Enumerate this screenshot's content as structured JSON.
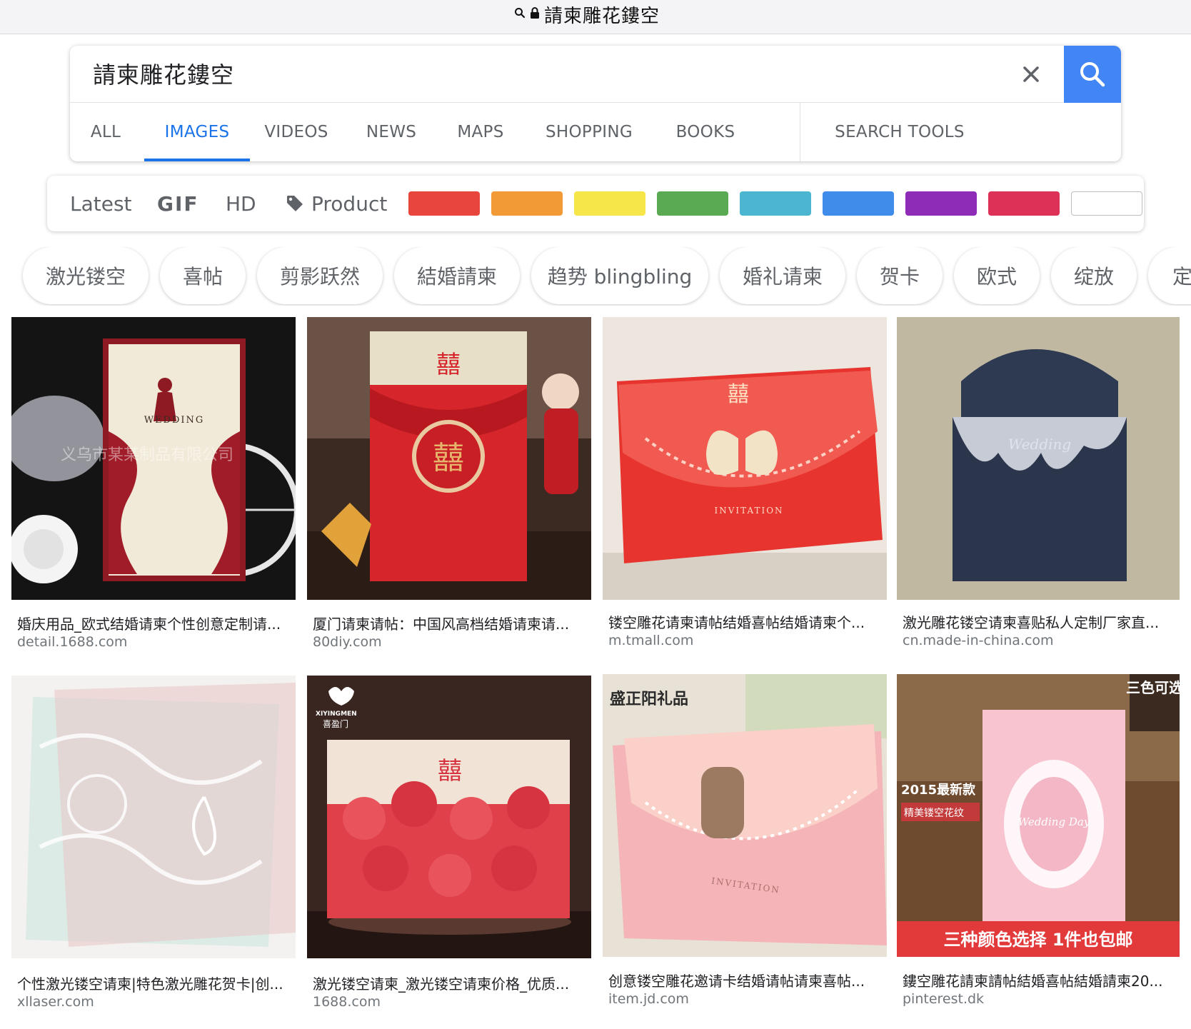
{
  "address_bar": {
    "url_text": "請柬雕花鏤空"
  },
  "search": {
    "query": "請柬雕花鏤空",
    "tabs": [
      {
        "label": "ALL",
        "active": false
      },
      {
        "label": "IMAGES",
        "active": true
      },
      {
        "label": "VIDEOS",
        "active": false
      },
      {
        "label": "NEWS",
        "active": false
      },
      {
        "label": "MAPS",
        "active": false
      },
      {
        "label": "SHOPPING",
        "active": false
      },
      {
        "label": "BOOKS",
        "active": false
      },
      {
        "label": "SEARCH TOOLS",
        "active": false
      }
    ],
    "accent_color": "#4285f4"
  },
  "filters": {
    "latest": "Latest",
    "gif": "GIF",
    "hd": "HD",
    "product": "Product",
    "colors": [
      "#e8453c",
      "#f29b36",
      "#f7e64a",
      "#5aaa54",
      "#4cb6d0",
      "#3f8ceb",
      "#8e2cb8",
      "#de3158",
      "#ffffff"
    ]
  },
  "chips": [
    "激光镂空",
    "喜帖",
    "剪影跃然",
    "結婚請柬",
    "趋势 blingbling",
    "婚礼请柬",
    "贺卡",
    "欧式",
    "绽放",
    "定"
  ],
  "results": [
    {
      "title": "婚庆用品_欧式结婚请柬个性创意定制请...",
      "source": "detail.1688.com"
    },
    {
      "title": "厦门请柬请帖：中国风高档结婚请柬请...",
      "source": "80diy.com"
    },
    {
      "title": "镂空雕花请柬请帖结婚喜帖结婚请柬个...",
      "source": "m.tmall.com"
    },
    {
      "title": "激光雕花镂空请柬喜贴私人定制厂家直...",
      "source": "cn.made-in-china.com"
    },
    {
      "title": "个性激光镂空请柬|特色激光雕花贺卡|创...",
      "source": "xllaser.com"
    },
    {
      "title": "激光镂空请柬_激光镂空请柬价格_优质...",
      "source": "1688.com"
    },
    {
      "title": "创意镂空雕花邀请卡结婚请帖请柬喜帖...",
      "source": "item.jd.com"
    },
    {
      "title": "鏤空雕花請柬請帖結婚喜帖結婚請柬20...",
      "source": "pinterest.dk"
    }
  ],
  "image_text": {
    "img1_card": "WEDDING",
    "img1_watermark": "义乌市某某制品有限公司",
    "img2_symbol": "囍",
    "img3_symbol": "囍",
    "img3_card": "INVITATION",
    "img4_card": "Wedding",
    "img6_brand": "XIYINGMEN",
    "img6_brand_cn": "喜盈门",
    "img6_symbol": "囍",
    "img7_brand": "盛正阳礼品",
    "img7_card": "INVITATION",
    "img8_corner": "三色可选",
    "img8_year": "2015最新款",
    "img8_sub": "精美镂空花纹",
    "img8_banner": "三种颜色选择  1件也包邮",
    "img8_card": "Wedding Day"
  }
}
